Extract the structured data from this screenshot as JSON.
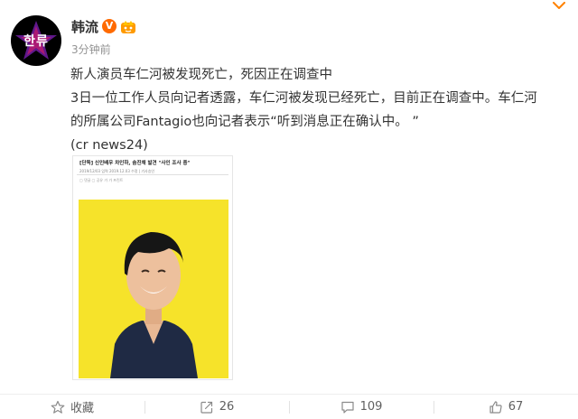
{
  "author": {
    "name": "韩流",
    "avatar_text": "한류",
    "verified_mark": "V"
  },
  "post": {
    "time": "3分钟前",
    "lines": [
      "新人演员车仁河被发现死亡，死因正在调查中",
      "3日一位工作人员向记者透露，车仁河被发现已经死亡，目前正在调查中。车仁河",
      "的所属公司Fantagio也向记者表示“听到消息正在确认中。 ”",
      "(cr news24)"
    ]
  },
  "image": {
    "headline": "[단독] 신인배우 차인하, 숨진채 발견 \"사인 조사 중\"",
    "meta": "2019/12/03  입력 2019.12.03  수정  |  기사승인",
    "tools": "▢ 댓글  ▢ 공유  가  가  프린트"
  },
  "actions": {
    "favorite_label": "收藏",
    "repost_count": "26",
    "comment_count": "109",
    "like_count": "67"
  },
  "colors": {
    "accent": "#ff8200",
    "background": "#ffffff",
    "photo_background": "#f6e32a",
    "shirt": "#1f2a44"
  }
}
